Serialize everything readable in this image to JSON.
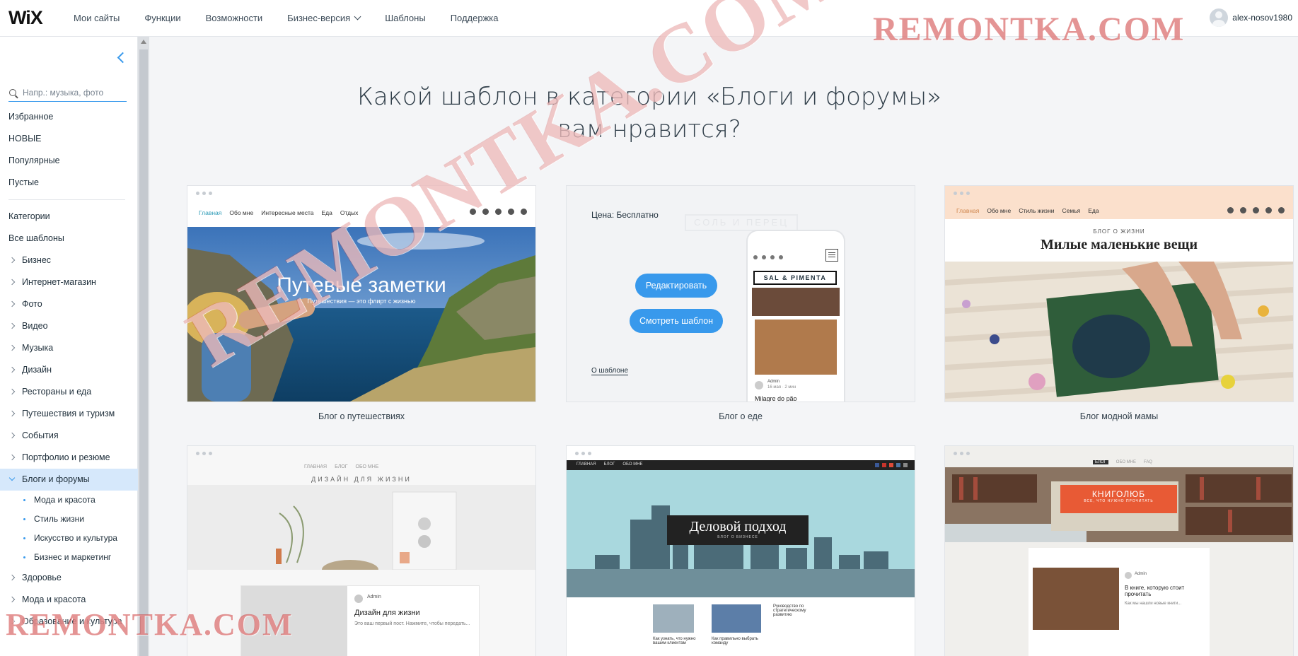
{
  "topbar": {
    "logo": "WiX",
    "nav": [
      {
        "label": "Мои сайты"
      },
      {
        "label": "Функции"
      },
      {
        "label": "Возможности"
      },
      {
        "label": "Бизнес-версия"
      },
      {
        "label": "Шаблоны"
      },
      {
        "label": "Поддержка"
      }
    ],
    "username": "alex-nosov1980"
  },
  "sidebar": {
    "search_placeholder": "Напр.: музыка, фото",
    "top_items": [
      "Избранное",
      "НОВЫЕ",
      "Популярные",
      "Пустые"
    ],
    "categories_label": "Категории",
    "all_templates": "Все шаблоны",
    "categories": [
      "Бизнес",
      "Интернет-магазин",
      "Фото",
      "Видео",
      "Музыка",
      "Дизайн",
      "Рестораны и еда",
      "Путешествия и туризм",
      "События",
      "Портфолио и резюме"
    ],
    "active_category": "Блоги и форумы",
    "subcategories": [
      "Мода и красота",
      "Стиль жизни",
      "Искусство и культура",
      "Бизнес и маркетинг"
    ],
    "categories_after": [
      "Здоровье",
      "Мода и красота",
      "Образование и культура"
    ]
  },
  "main": {
    "headline_line1": "Какой шаблон в категории «Блоги и форумы»",
    "headline_line2": "вам нравится?",
    "cards": [
      {
        "label": "Блог о путешествиях",
        "nav": [
          "Главная",
          "Обо мне",
          "Интересные места",
          "Еда",
          "Отдых"
        ],
        "hero_title": "Путевые заметки",
        "hero_subtitle": "Путешествия — это флирт с жизнью"
      },
      {
        "label": "Блог о еде",
        "price": "Цена: Бесплатно",
        "edit_button": "Редактировать",
        "view_button": "Смотреть шаблон",
        "about_link": "О шаблоне",
        "phone_brand": "SAL & PIMENTA",
        "phone_bg_brand": "СОЛЬ И ПЕРЕЦ",
        "phone_author": "Admin",
        "phone_meta": "16 мая · 2 мин",
        "phone_post": "Milagre do pão"
      },
      {
        "label": "Блог модной мамы",
        "nav": [
          "Главная",
          "Обо мне",
          "Стиль жизни",
          "Семья",
          "Еда"
        ],
        "kicker": "БЛОГ О ЖИЗНИ",
        "title": "Милые маленькие вещи"
      },
      {
        "nav": [
          "ГЛАВНАЯ",
          "БЛОГ",
          "ОБО МНЕ"
        ],
        "banner": "ДИЗАЙН ДЛЯ ЖИЗНИ",
        "author": "Admin",
        "post_title": "Дизайн для жизни",
        "post_excerpt": "Это ваш первый пост. Нажмите, чтобы передать..."
      },
      {
        "nav": [
          "ГЛАВНАЯ",
          "БЛОГ",
          "ОБО МНЕ"
        ],
        "hero_title": "Деловой подход",
        "hero_subtitle": "БЛОГ О БИЗНЕСЕ",
        "post1": "Руководство по стратегическому развитию",
        "post2": "Как узнать, что нужно вашим клиентам",
        "post3": "Как правильно выбрать команду"
      },
      {
        "nav": [
          "БЛОГ",
          "ОБО МНЕ",
          "FAQ"
        ],
        "badge_title": "КНИГОЛЮБ",
        "badge_subtitle": "ВСЕ, ЧТО НУЖНО ПРОЧИТАТЬ",
        "author": "Admin",
        "post_title": "В книге, которую стоит прочитать",
        "post_excerpt": "Как мы нашли новые книги..."
      }
    ]
  },
  "watermark": "REMONTKA.COM",
  "colors": {
    "accent": "#3899ec",
    "watermark": "#cd3c3c",
    "active_bg": "#d6e8fb"
  }
}
